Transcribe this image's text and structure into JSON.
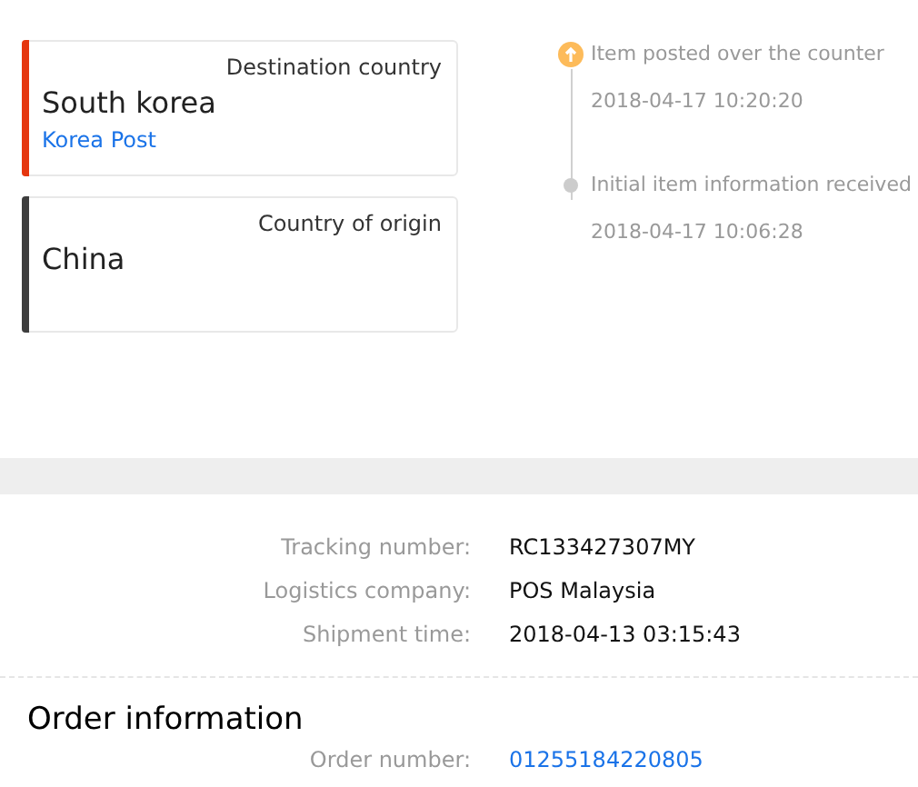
{
  "countries": [
    {
      "label": "Destination country",
      "name": "South korea",
      "carrier": "Korea Post",
      "color": "#e5360e"
    },
    {
      "label": "Country of origin",
      "name": "China",
      "color": "#3d3d3d"
    }
  ],
  "timeline": [
    {
      "kind": "latest",
      "event": "Item posted over the counter",
      "time": "2018-04-17 10:20:20"
    },
    {
      "kind": "past",
      "event": "Initial item information received",
      "time": "2018-04-17 10:06:28"
    }
  ],
  "shipment": [
    {
      "label": "Tracking number:",
      "value": "RC133427307MY"
    },
    {
      "label": "Logistics company:",
      "value": "POS Malaysia"
    },
    {
      "label": "Shipment time:",
      "value": "2018-04-13 03:15:43"
    }
  ],
  "order": {
    "title": "Order information",
    "rows": [
      {
        "label": "Order number:",
        "value": "01255184220805",
        "kind": "link"
      }
    ]
  }
}
